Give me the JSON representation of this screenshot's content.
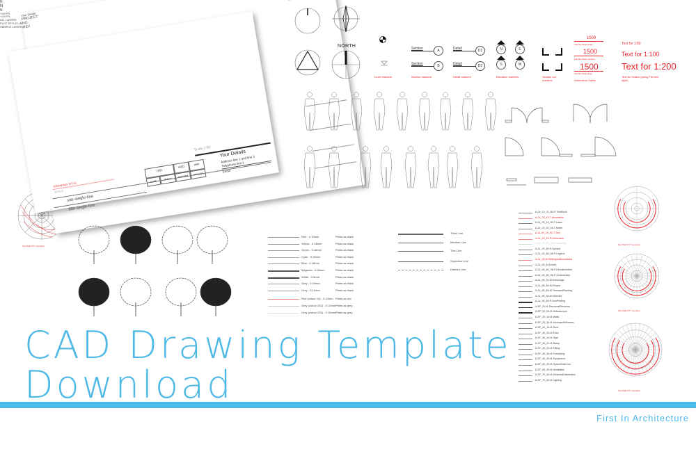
{
  "headline": {
    "line1": "CAD Drawing Template",
    "line2": "Download"
  },
  "brand": "First In Architecture",
  "colors": {
    "accent": "#4cb8e6",
    "band": "#4cbbe8",
    "cad_red": "#e8262b"
  },
  "title_block": {
    "drawing_title": "DRAWING TITLE",
    "scale_label": "SCALE",
    "site_line_1": "site-single-line",
    "site_line_2": "title-single-line",
    "cells": {
      "project_no": "1001",
      "drawing_no": "A001",
      "date": "date",
      "scale": "scale",
      "drawn": "drawn",
      "checked": "checked",
      "revision": "revision"
    },
    "scale_bar": "Scale  1:50",
    "your_details": "Your Details",
    "address": "Address line 1 and line 2",
    "telephone": "Telephone line 1",
    "email": "Email",
    "vertical_block": {
      "project": "PROJECT",
      "no": "NO",
      "rev": "REV",
      "your_details": "Your Details"
    }
  },
  "north_arrows": {
    "n": "N",
    "north": "NORTH"
  },
  "markers": {
    "level_values": [
      "+100 FFL",
      "+100 FFL"
    ],
    "level_caption": "Level markers",
    "section_label": "Section",
    "section_letters": [
      "A",
      "B"
    ],
    "section_caption": "Section markers",
    "detail_label": "Detail",
    "detail_codes": [
      "D1",
      "D2"
    ],
    "detail_caption": "Detail markers",
    "elevation_letters": [
      "N",
      "E",
      "S",
      "W"
    ],
    "elevation_caption": "Elevation markers",
    "section_cut_caption": "Section cut markers"
  },
  "dimensions": {
    "values": [
      "1500",
      "1500",
      "1500"
    ],
    "captions": [
      "FIA Dim Style small",
      "FIA Dim Style medium",
      "FIA Dim Style large"
    ],
    "caption": "Dimension Styles"
  },
  "text_scales": {
    "items": [
      "Text for  1:50",
      "Text for  1:100",
      "Text for  1:200"
    ],
    "caption": "Text for Scales (using FIA text style)"
  },
  "plot_styles": {
    "title": "PLOT STYLE LINEWEIGHTS",
    "rows": [
      {
        "name": "Red - 0.10mm",
        "prints": "Prints as black",
        "color": "#999"
      },
      {
        "name": "Yellow - 0.18mm",
        "prints": "Prints as black",
        "color": "#999"
      },
      {
        "name": "Green - 0.18mm",
        "prints": "Prints as black",
        "color": "#999"
      },
      {
        "name": "Cyan - 0.25mm",
        "prints": "Prints as black",
        "color": "#aaa"
      },
      {
        "name": "Blue - 0.18mm",
        "prints": "Prints as black",
        "color": "#999"
      },
      {
        "name": "Magenta - 0.35mm",
        "prints": "Prints as black",
        "color": "#555"
      },
      {
        "name": "White - 0.5mm",
        "prints": "Prints as black",
        "color": "#444"
      },
      {
        "name": "Grey - 0.10mm",
        "prints": "Prints as black",
        "color": "#999"
      },
      {
        "name": "Grey - 0.13mm",
        "prints": "Prints as black",
        "color": "#999"
      },
      {
        "name": "Red (colour 10) - 0.10mm",
        "prints": "Prints as red",
        "color": "#f08c8f"
      },
      {
        "name": "Grey (colour 252) - 0.10mm",
        "prints": "Prints as grey",
        "color": "#ccc"
      },
      {
        "name": "Grey (colour 253) - 0.15mm",
        "prints": "Prints as grey",
        "color": "#ddd"
      }
    ]
  },
  "sample_layers": {
    "title": "SAMPLE LAYERS",
    "rows": [
      "Thick Line",
      "Medium Line",
      "Thin Line",
      "Superfine Line",
      "Dashed Line"
    ]
  },
  "all_layers": {
    "title": "ALL LAYERS",
    "rows": [
      {
        "name": "A-Zz_10_20_88-P-TitleBlock",
        "red": false
      },
      {
        "name": "A-Zz_20_10-T-Annotation",
        "red": true
      },
      {
        "name": "A-Zz_20_10_40-T-Label",
        "red": false
      },
      {
        "name": "A-Zz_20_10_55-T-Notes",
        "red": false
      },
      {
        "name": "A-Zz-20_10_90-T-Text",
        "red": true
      },
      {
        "name": "A-Zz_20_20-P-Dimension",
        "red": true
      },
      {
        "name": "A-Zz_20_40_35-H-Hatching",
        "red": false,
        "faint": true
      },
      {
        "name": "A-Zz_20_80-P-Symbol",
        "red": false
      },
      {
        "name": "A-Zz_20_80_58-P-Legend",
        "red": false
      },
      {
        "name": "A-Zz_30-M-SettingoutBoundaries",
        "red": true
      },
      {
        "name": "A-Zz_60_M-Levels",
        "red": false
      },
      {
        "name": "A-Zz_60_80_38-P-ElevationMark",
        "red": false
      },
      {
        "name": "A-Zz_60_80_88-P-SectionMark",
        "red": false
      },
      {
        "name": "A-Zz_80_30-M-Entourage",
        "red": false
      },
      {
        "name": "A-Zz_80_60-M-People",
        "red": false
      },
      {
        "name": "A-Zz_80_65-M-TreesandPlanting",
        "red": false
      },
      {
        "name": "A-Zz_80_90-M-Vehicles",
        "red": false
      },
      {
        "name": "A-Zz_90_80-P-NonPlotting",
        "red": false
      },
      {
        "name": "A-EF_20-M-StructuralElements",
        "red": false
      },
      {
        "name": "A-EF_20_05-M-Substructure",
        "red": false
      },
      {
        "name": "A-EF_25_10-M-Walls",
        "red": false
      },
      {
        "name": "A-EF_25_30-M-DoorsandWindows",
        "red": false
      },
      {
        "name": "A-EF_30_10-M-Roof",
        "red": false
      },
      {
        "name": "A-EF_30_20-M-Floor",
        "red": false
      },
      {
        "name": "A-EF_35_10-M-Stair",
        "red": false
      },
      {
        "name": "A-EF_35_20-M-Ramp",
        "red": false
      },
      {
        "name": "A-EF_45_20-M-Fitting",
        "red": false
      },
      {
        "name": "A-EF_45_30-M-Furnishing",
        "red": false
      },
      {
        "name": "A-EF_45_40-M-Equipment",
        "red": false
      },
      {
        "name": "A-EF_60_40-M-SpaceHeatCool",
        "red": false
      },
      {
        "name": "A-EF_65_40-M-Ventilation",
        "red": false
      },
      {
        "name": "A-EF_70_30-M-ElectricalDistribution",
        "red": false
      },
      {
        "name": "A-EF_70_80-M-Lighting",
        "red": false
      }
    ]
  },
  "sun_paths": {
    "captions": [
      "Sun Path STY (London)",
      "Sun Path STY (London)",
      "Sun Path STY (London)"
    ]
  }
}
